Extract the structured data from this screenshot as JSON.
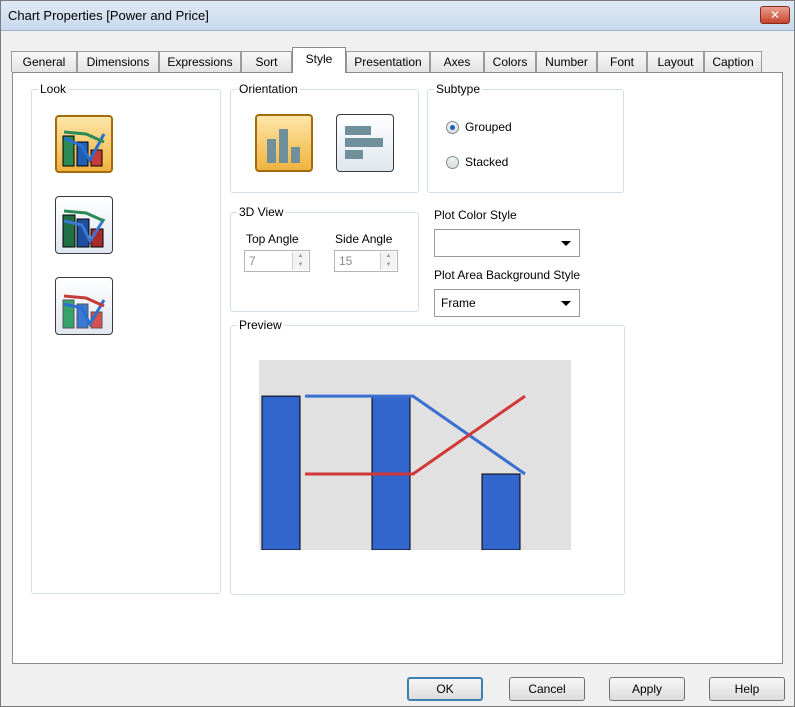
{
  "window": {
    "title": "Chart Properties [Power and Price]",
    "close_glyph": "✕"
  },
  "tabs": [
    {
      "label": "General"
    },
    {
      "label": "Dimensions"
    },
    {
      "label": "Expressions"
    },
    {
      "label": "Sort"
    },
    {
      "label": "Style"
    },
    {
      "label": "Presentation"
    },
    {
      "label": "Axes"
    },
    {
      "label": "Colors"
    },
    {
      "label": "Number"
    },
    {
      "label": "Font"
    },
    {
      "label": "Layout"
    },
    {
      "label": "Caption"
    }
  ],
  "active_tab": "Style",
  "look": {
    "label": "Look",
    "selected_index": 0,
    "icons": [
      "look-style-1-icon",
      "look-style-2-icon",
      "look-style-3-icon"
    ]
  },
  "orientation": {
    "label": "Orientation",
    "selected": "vertical",
    "icons": [
      "vertical-bars-icon",
      "horizontal-bars-icon"
    ]
  },
  "subtype": {
    "label": "Subtype",
    "options": [
      {
        "label": "Grouped",
        "checked": true
      },
      {
        "label": "Stacked",
        "checked": false
      }
    ]
  },
  "view3d": {
    "label": "3D View",
    "top_angle_label": "Top Angle",
    "top_angle_value": "7",
    "side_angle_label": "Side Angle",
    "side_angle_value": "15"
  },
  "plot_color_style": {
    "label": "Plot Color Style",
    "value": ""
  },
  "plot_area_bg": {
    "label": "Plot Area Background Style",
    "value": "Frame"
  },
  "preview": {
    "label": "Preview",
    "bars": [
      0.81,
      0.81,
      0.4
    ],
    "line_series": [
      {
        "color": "#3b6fd2",
        "values": [
          0.81,
          0.81,
          0.4
        ]
      },
      {
        "color": "#d23838",
        "values": [
          0.4,
          0.4,
          0.81
        ]
      }
    ],
    "bar_color": "#3366cc",
    "background_color": "#e1e1e1"
  },
  "buttons": {
    "ok": "OK",
    "cancel": "Cancel",
    "apply": "Apply",
    "help": "Help"
  }
}
